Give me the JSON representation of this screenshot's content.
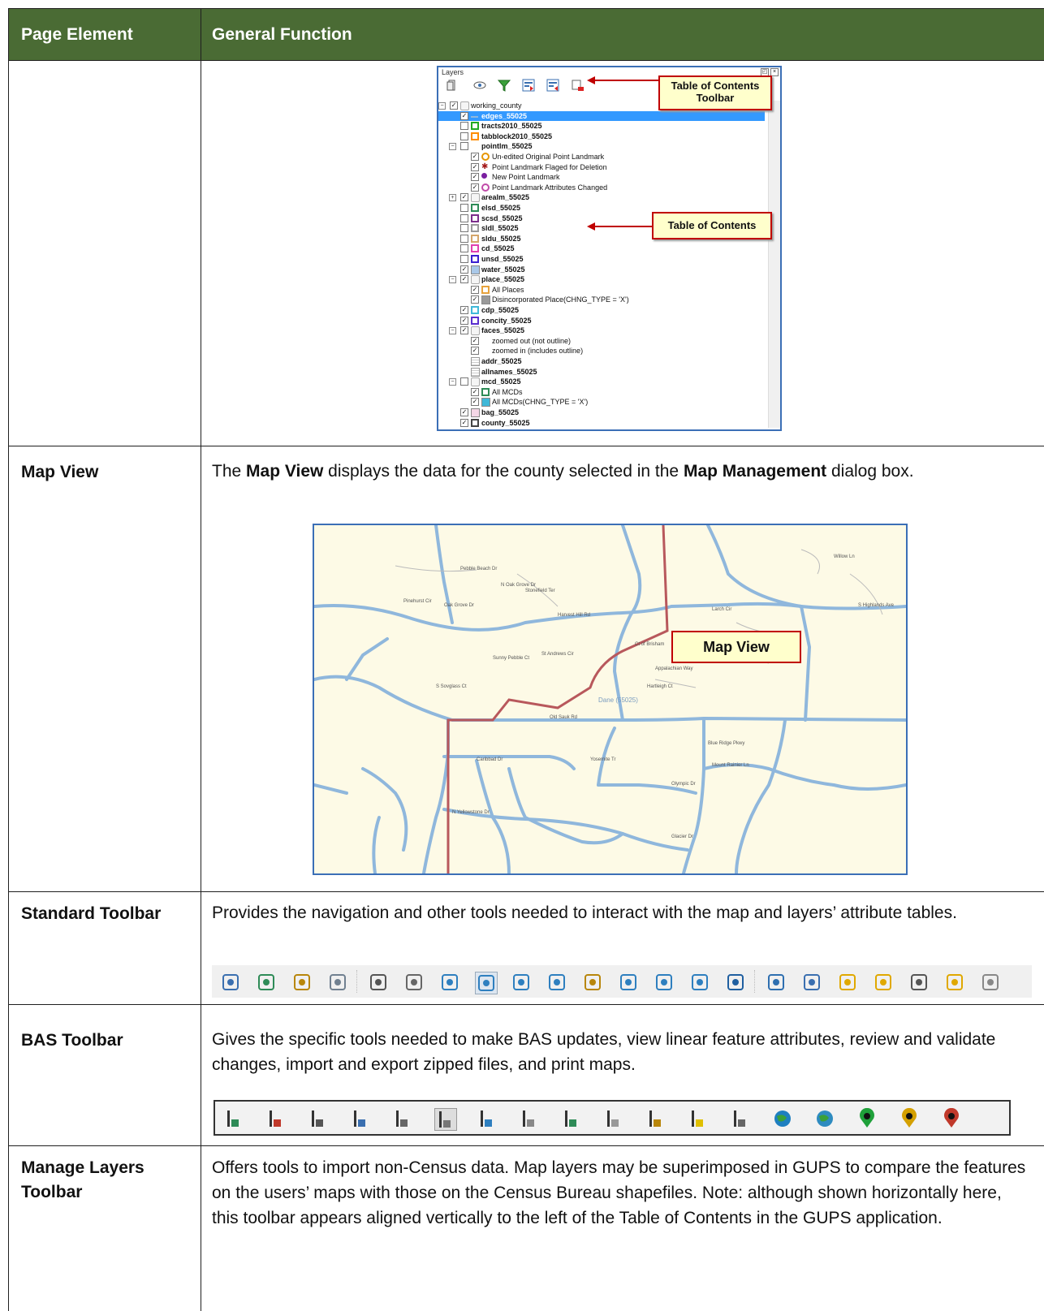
{
  "table": {
    "col1_header": "Page Element",
    "col2_header": "General Function"
  },
  "layers_panel": {
    "title": "Layers",
    "callout_toolbar": "Table of Contents Toolbar",
    "callout_toc": "Table of Contents",
    "tree": [
      {
        "label": "working_county",
        "checked": true,
        "bold": false,
        "indent": 0,
        "swatch": "group"
      },
      {
        "label": "edges_55025",
        "checked": true,
        "bold": true,
        "indent": 1,
        "swatch": "line",
        "selected": true
      },
      {
        "label": "tracts2010_55025",
        "checked": false,
        "bold": true,
        "indent": 1,
        "swatch": "#22aa22"
      },
      {
        "label": "tabblock2010_55025",
        "checked": false,
        "bold": true,
        "indent": 1,
        "swatch": "#ff8c00"
      },
      {
        "label": "pointlm_55025",
        "checked": false,
        "bold": true,
        "indent": 1,
        "swatch": "none"
      },
      {
        "label": "Un-edited Original Point Landmark",
        "checked": true,
        "bold": false,
        "indent": 2,
        "swatch": "dot-orange"
      },
      {
        "label": "Point Landmark Flaged for Deletion",
        "checked": true,
        "bold": false,
        "indent": 2,
        "swatch": "star-red"
      },
      {
        "label": "New Point Landmark",
        "checked": true,
        "bold": false,
        "indent": 2,
        "swatch": "dot-purple"
      },
      {
        "label": "Point Landmark Attributes Changed",
        "checked": true,
        "bold": false,
        "indent": 2,
        "swatch": "dot-pink"
      },
      {
        "label": "arealm_55025",
        "checked": true,
        "bold": true,
        "indent": 1,
        "swatch": "group"
      },
      {
        "label": "elsd_55025",
        "checked": false,
        "bold": true,
        "indent": 1,
        "swatch": "#2e8b57"
      },
      {
        "label": "scsd_55025",
        "checked": false,
        "bold": true,
        "indent": 1,
        "swatch": "#7b2d8b"
      },
      {
        "label": "sldl_55025",
        "checked": false,
        "bold": true,
        "indent": 1,
        "swatch": "#999999"
      },
      {
        "label": "sldu_55025",
        "checked": false,
        "bold": true,
        "indent": 1,
        "swatch": "#d4a56a"
      },
      {
        "label": "cd_55025",
        "checked": false,
        "bold": true,
        "indent": 1,
        "swatch": "#e040b0"
      },
      {
        "label": "unsd_55025",
        "checked": false,
        "bold": true,
        "indent": 1,
        "swatch": "#3a1fd0"
      },
      {
        "label": "water_55025",
        "checked": true,
        "bold": true,
        "indent": 1,
        "swatch": "fill-#a9c8e8"
      },
      {
        "label": "place_55025",
        "checked": true,
        "bold": true,
        "indent": 1,
        "swatch": "group"
      },
      {
        "label": "All Places",
        "checked": true,
        "bold": false,
        "indent": 2,
        "swatch": "#e6a23c"
      },
      {
        "label": "Disincorporated Place(CHNG_TYPE = 'X')",
        "checked": true,
        "bold": false,
        "indent": 2,
        "swatch": "fill-#999999"
      },
      {
        "label": "cdp_55025",
        "checked": true,
        "bold": true,
        "indent": 1,
        "swatch": "#3fb8d8"
      },
      {
        "label": "concity_55025",
        "checked": true,
        "bold": true,
        "indent": 1,
        "swatch": "#5a2fd0"
      },
      {
        "label": "faces_55025",
        "checked": true,
        "bold": true,
        "indent": 1,
        "swatch": "group"
      },
      {
        "label": "zoomed out (not outline)",
        "checked": true,
        "bold": false,
        "indent": 2,
        "swatch": "none"
      },
      {
        "label": "zoomed in (includes outline)",
        "checked": true,
        "bold": false,
        "indent": 2,
        "swatch": "none"
      },
      {
        "label": "addr_55025",
        "checked": null,
        "bold": true,
        "indent": 1,
        "swatch": "table"
      },
      {
        "label": "allnames_55025",
        "checked": null,
        "bold": true,
        "indent": 1,
        "swatch": "table"
      },
      {
        "label": "mcd_55025",
        "checked": false,
        "bold": true,
        "indent": 1,
        "swatch": "group"
      },
      {
        "label": "All MCDs",
        "checked": true,
        "bold": false,
        "indent": 2,
        "swatch": "#2e8b57"
      },
      {
        "label": "All MCDs(CHNG_TYPE = 'X')",
        "checked": true,
        "bold": false,
        "indent": 2,
        "swatch": "fill-#3fb8d8"
      },
      {
        "label": "bag_55025",
        "checked": true,
        "bold": true,
        "indent": 1,
        "swatch": "fill-#f4d7e6"
      },
      {
        "label": "county_55025",
        "checked": true,
        "bold": true,
        "indent": 1,
        "swatch": "#444444"
      }
    ]
  },
  "rows": [
    {
      "name": "Map View",
      "text_parts": [
        "The ",
        "Map View",
        " displays the data for the county selected in the ",
        "Map Management",
        " dialog box."
      ]
    },
    {
      "name": "Standard Toolbar",
      "text": "Provides the navigation and other tools needed to interact with the map and layers’ attribute tables."
    },
    {
      "name": "BAS Toolbar",
      "text": "Gives the specific tools needed to make BAS updates, view linear feature attributes, review and validate changes, import and export zipped files, and print maps."
    },
    {
      "name": "Manage Layers Toolbar",
      "text": "Offers tools to import non-Census data. Map layers may be superimposed in GUPS to compare the features on the users’ maps with those on the Census Bureau shapefiles. Note: although shown horizontally here, this toolbar appears aligned vertically to the left of the Table of Contents in the GUPS application."
    }
  ],
  "map": {
    "callout": "Map View",
    "county_label": "Dane (55025)",
    "road_labels": [
      "Pebble Beach Dr",
      "N Oak Grove Dr",
      "Pinehurst Cir",
      "Oak Grove Dr",
      "Stonefield Ter",
      "Harvest Hill Rd",
      "Old Sauk Rd",
      "S Sovglass Ct",
      "Appalachian Way",
      "Hartleigh Ct",
      "Mount Rainier Ln",
      "Olympic Dr",
      "Caribbad Dr",
      "N Yellowstone Dr",
      "Glacier Dr",
      "Ct of Brisham",
      "S Highlands Ave",
      "Larch Cir",
      "Willow Ln",
      "Blue Ridge Pkwy",
      "Yosemite Tr",
      "St Andrews Cir",
      "Sunny Pebble Ct"
    ]
  },
  "standard_toolbar": {
    "icons": [
      "save-icon",
      "new-map-icon",
      "pencil-icon",
      "measure-icon",
      "select-pointer-icon",
      "pan-hand-icon",
      "pan-to-selection-icon",
      "zoom-in-icon",
      "zoom-out-icon",
      "zoom-full-icon",
      "zoom-to-selection-icon",
      "zoom-to-layer-icon",
      "zoom-last-icon",
      "zoom-next-icon",
      "refresh-icon",
      "identify-icon",
      "select-features-icon",
      "deselect-icon",
      "select-by-expression-icon",
      "measure-line-icon",
      "add-label-icon",
      "annotation-icon"
    ]
  },
  "bas_toolbar": {
    "icons": [
      "add-feature-icon",
      "delete-feature-icon",
      "split-feature-icon",
      "address-range-icon",
      "attribute-table-icon",
      "edit-attributes-icon",
      "validation-icon",
      "hierarchy-icon",
      "review-changes-icon",
      "boundary-edit-icon",
      "import-zip-icon",
      "export-zip-icon",
      "export-changes-icon",
      "globe-icon",
      "add-web-layer-icon",
      "add-point-icon",
      "edit-point-icon",
      "delete-point-icon"
    ]
  },
  "colors": {
    "header_bg": "#4a6b34",
    "road_blue": "#8fb7dc",
    "boundary_red": "#b8585c",
    "callout_border": "#c00000",
    "callout_bg": "#ffffcc"
  }
}
